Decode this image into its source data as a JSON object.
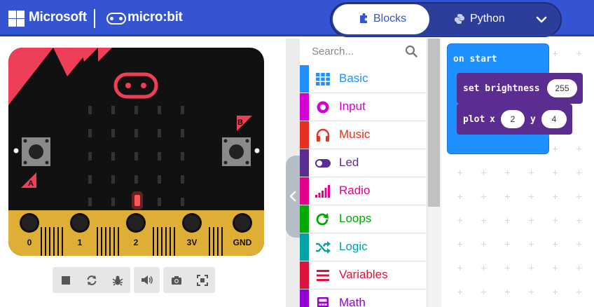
{
  "header": {
    "brand": "Microsoft",
    "product": "micro:bit",
    "modes": [
      {
        "label": "Blocks",
        "icon": "puzzle-piece-icon",
        "active": true
      },
      {
        "label": "Python",
        "icon": "python-icon",
        "active": false
      }
    ],
    "menu_icon": "chevron-down-icon"
  },
  "simulator": {
    "buttons": {
      "a": "A",
      "b": "B"
    },
    "pins": [
      "0",
      "1",
      "2",
      "3V",
      "GND"
    ],
    "lit_led": {
      "row": 4,
      "col": 3
    },
    "toolbar": [
      {
        "icon": "stop-icon"
      },
      {
        "icon": "restart-icon"
      },
      {
        "icon": "debug-icon"
      },
      {
        "icon": "mute-icon"
      },
      {
        "icon": "screenshot-icon"
      },
      {
        "icon": "fullscreen-icon"
      }
    ]
  },
  "toolbox": {
    "search_placeholder": "Search...",
    "categories": [
      {
        "label": "Basic",
        "color": "#1E90FF",
        "icon": "grid-icon"
      },
      {
        "label": "Input",
        "color": "#D400D4",
        "icon": "target-icon"
      },
      {
        "label": "Music",
        "color": "#E63022",
        "icon": "headphones-icon"
      },
      {
        "label": "Led",
        "color": "#5C2D91",
        "icon": "toggle-icon"
      },
      {
        "label": "Radio",
        "color": "#E3008C",
        "icon": "signal-bars-icon"
      },
      {
        "label": "Loops",
        "color": "#00AA00",
        "icon": "refresh-icon"
      },
      {
        "label": "Logic",
        "color": "#00A4A6",
        "icon": "shuffle-icon"
      },
      {
        "label": "Variables",
        "color": "#DC143C",
        "icon": "list-icon"
      },
      {
        "label": "Math",
        "color": "#9400D3",
        "icon": "calculator-icon"
      }
    ]
  },
  "workspace": {
    "on_start_label": "on start",
    "set_brightness": {
      "label": "set brightness",
      "value": "255"
    },
    "plot": {
      "label": "plot",
      "x_label": "x",
      "x_value": "2",
      "y_label": "y",
      "y_value": "4"
    }
  }
}
